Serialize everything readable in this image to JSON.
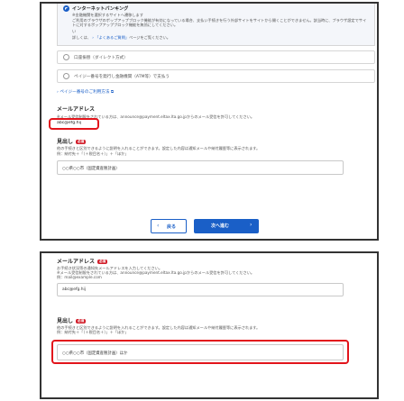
{
  "top": {
    "bank_label": "インターネットバンキング",
    "bank_notes": [
      "※金融機関を選択するサイトへ遷移します",
      "ご利用のブラウザのポップアップブロック機能が有効になっている場合、支払い手続きを行う外部サイトをサイトから開くことができません。該当時に、ブラウザ設定でサイトに対するポップアップブロック機能を無効にしてください。",
      "い"
    ],
    "faq_prefix": "詳しくは、",
    "faq_link": "「よくあるご質問」",
    "faq_suffix": "ページをご覧ください。",
    "options": [
      "口座振替（ダイレクト方式）",
      "ペイジー番号を発行し金融機関（ATM等）で支払う"
    ],
    "payeasy_link": "ペイジー番号のご利用方法",
    "email_title": "メールアドレス",
    "email_note": "※メール受信制限をされている方は、announce@payment.eltax.lta.go.jpからのメール受信を許可してください。",
    "email_value": "abc@efg.hij",
    "midashi_title": "見出し",
    "req_badge": "必須",
    "midashi_note1": "他の手続きと区別できるように説明を入れることができます。設定した内容は通知メールや納付履歴等に表示されます。",
    "midashi_note2": "例：納付先＋「（＋税目名＋）」＋「ほか」",
    "midashi_value": "○○県○○市（固定資産税計画）",
    "back_label": "戻る",
    "next_label": "次へ進む"
  },
  "bottom": {
    "email_title": "メールアドレス",
    "req_badge": "必須",
    "email_note1": "お手続き状況等の通知先メールアドレスを入力してください。",
    "email_note2": "※メール受信制限をされている方は、announce@payment.eltax.lta.go.jpからのメール受信を許可してください。",
    "email_example": "例：mail@example.com",
    "email_value": "abc@efg.hij",
    "midashi_title": "見出し",
    "midashi_note1": "他の手続きと区別できるように説明を入れることができます。設定した内容は通知メールや納付履歴等に表示されます。",
    "midashi_note2": "例：納付先＋「（＋税目名＋）」＋「ほか」",
    "midashi_value": "○○県○○市（固定資産税計画）ほか"
  }
}
